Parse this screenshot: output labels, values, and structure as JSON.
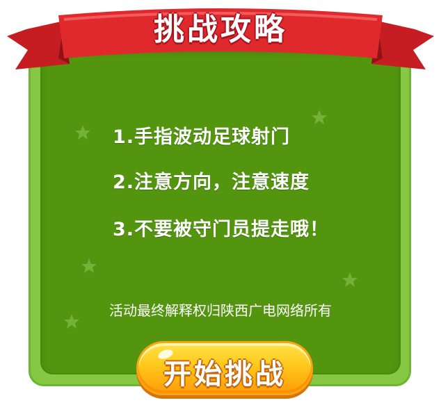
{
  "banner": {
    "title": "挑战攻略"
  },
  "rules": [
    "1.手指波动足球射门",
    "2.注意方向，注意速度",
    "3.不要被守门员提走哦！"
  ],
  "footer": {
    "text": "活动最终解释权归陕西广电网络所有"
  },
  "start_button": {
    "label": "开始挑战"
  },
  "colors": {
    "board_outer": "#86c844",
    "board_inner": "#53950f",
    "ribbon_red": "#e0292d",
    "button_yellow": "#ffc81a"
  }
}
